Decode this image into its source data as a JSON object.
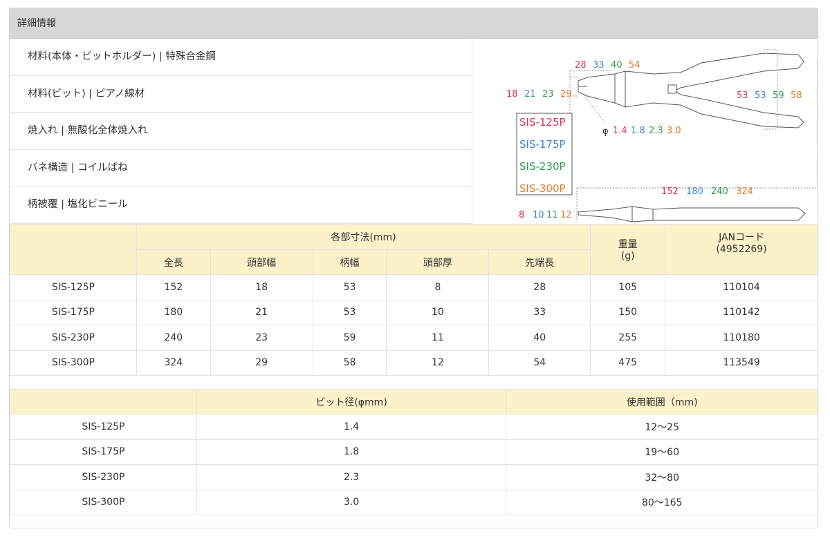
{
  "header": {
    "title": "詳細情報"
  },
  "specs": [
    {
      "text": "材料(本体・ビットホルダー) | 特殊合金鋼"
    },
    {
      "text": "材料(ビット) | ピアノ線材"
    },
    {
      "text": "焼入れ | 無酸化全体焼入れ"
    },
    {
      "text": "バネ構造 | コイルばね"
    },
    {
      "text": "柄被覆 | 塩化ビニール"
    }
  ],
  "diagram": {
    "colors": [
      "#d6335a",
      "#3a86c2",
      "#2e9e4a",
      "#e07b2a"
    ],
    "tip_length": [
      "28",
      "33",
      "40",
      "54"
    ],
    "head_width": [
      "18",
      "21",
      "23",
      "29"
    ],
    "handle_width": [
      "53",
      "53",
      "59",
      "58"
    ],
    "bit_diameter_prefix": "φ",
    "bit_diameter": [
      "1.4",
      "1.8",
      "2.3",
      "3.0"
    ],
    "models": [
      "SIS-125P",
      "SIS-175P",
      "SIS-230P",
      "SIS-300P"
    ],
    "total_length": [
      "152",
      "180",
      "240",
      "324"
    ],
    "head_thickness": [
      "8",
      "10",
      "11",
      "12"
    ],
    "line_color": "#555555",
    "body_fill": "#ffffff"
  },
  "table1": {
    "dims_header": "各部寸法(mm)",
    "weight_header": "重量",
    "weight_unit": "(g)",
    "jan_header": "JANコード",
    "jan_prefix": "(4952269)",
    "sub_headers": [
      "全長",
      "頭部幅",
      "柄幅",
      "頭部厚",
      "先端長"
    ],
    "rows": [
      [
        "SIS-125P",
        "152",
        "18",
        "53",
        "8",
        "28",
        "105",
        "110104"
      ],
      [
        "SIS-175P",
        "180",
        "21",
        "53",
        "10",
        "33",
        "150",
        "110142"
      ],
      [
        "SIS-230P",
        "240",
        "23",
        "59",
        "11",
        "40",
        "255",
        "110180"
      ],
      [
        "SIS-300P",
        "324",
        "29",
        "58",
        "12",
        "54",
        "475",
        "113549"
      ]
    ]
  },
  "table2": {
    "headers": [
      "",
      "ビット径(φmm)",
      "使用範囲（mm)"
    ],
    "rows": [
      [
        "SIS-125P",
        "1.4",
        "12～25"
      ],
      [
        "SIS-175P",
        "1.8",
        "19～60"
      ],
      [
        "SIS-230P",
        "2.3",
        "32～80"
      ],
      [
        "SIS-300P",
        "3.0",
        "80～165"
      ]
    ]
  }
}
